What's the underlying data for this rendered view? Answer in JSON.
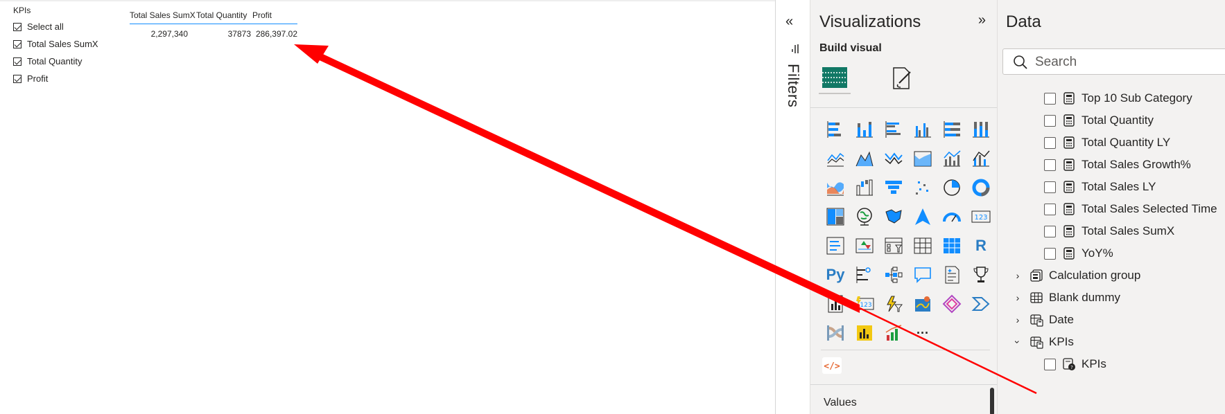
{
  "slicer": {
    "title": "KPIs",
    "items": [
      {
        "label": "Select all",
        "checked": true
      },
      {
        "label": "Total Sales SumX",
        "checked": true
      },
      {
        "label": "Total Quantity",
        "checked": true
      },
      {
        "label": "Profit",
        "checked": true
      }
    ]
  },
  "table_visual": {
    "headers": [
      "Total Sales SumX",
      "Total Quantity",
      "Profit"
    ],
    "row": [
      "2,297,340",
      "37873",
      "286,397.02"
    ]
  },
  "filters": {
    "collapse_glyph": "«",
    "label": "Filters"
  },
  "visualizations": {
    "title": "Visualizations",
    "expand_glyph": "»",
    "build_visual": "Build visual",
    "values_label": "Values",
    "more_glyph": "···",
    "code_glyph": "</>",
    "r_glyph": "R",
    "py_glyph": "Py"
  },
  "data": {
    "title": "Data",
    "search_placeholder": "Search",
    "measures": [
      "Top 10 Sub Category",
      "Total Quantity",
      "Total Quantity LY",
      "Total Sales Growth%",
      "Total Sales LY",
      "Total Sales Selected Time",
      "Total Sales SumX",
      "YoY%"
    ],
    "tables": [
      {
        "label": "Calculation group",
        "expanded": false
      },
      {
        "label": "Blank dummy",
        "expanded": false
      },
      {
        "label": "Date",
        "expanded": false
      },
      {
        "label": "KPIs",
        "expanded": true
      }
    ],
    "kpi_field": "KPIs"
  },
  "colors": {
    "accent_blue": "#118dff",
    "arrow_red": "#ff0000",
    "pane_bg": "#f3f2f1"
  }
}
